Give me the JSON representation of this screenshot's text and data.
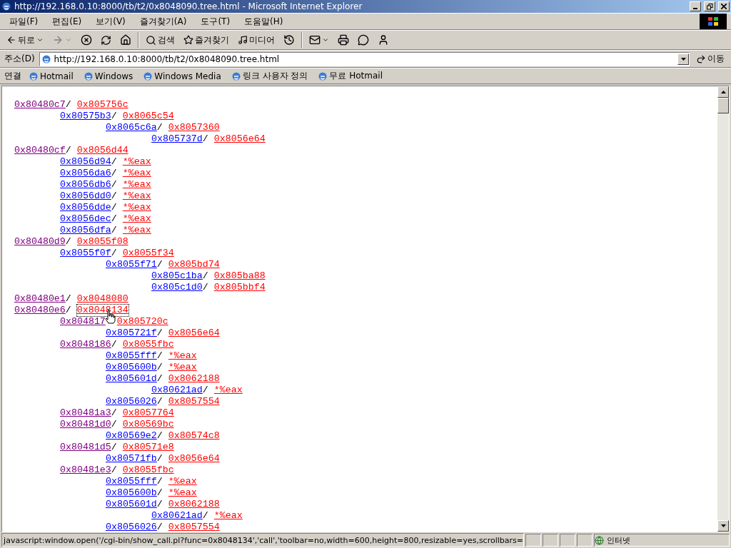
{
  "window": {
    "title": "http://192.168.0.10:8000/tb/t2/0x8048090.tree.html - Microsoft Internet Explorer"
  },
  "menu": [
    "파일(F)",
    "편집(E)",
    "보기(V)",
    "즐겨찾기(A)",
    "도구(T)",
    "도움말(H)"
  ],
  "toolbar": {
    "back": "뒤로",
    "search": "검색",
    "favorites": "즐겨찾기",
    "media": "미디어",
    "forward_disabled": true
  },
  "address_bar": {
    "label": "주소(D)",
    "value": "http://192.168.0.10:8000/tb/t2/0x8048090.tree.html",
    "go": "이동"
  },
  "links_bar": {
    "label": "연결",
    "links": [
      "Hotmail",
      "Windows",
      "Windows Media",
      "링크 사용자 정의",
      "무료 Hotmail"
    ]
  },
  "tree": [
    {
      "address": "0x80480c7",
      "visited": true,
      "separator": "/",
      "target": "0x805756c",
      "focused": false,
      "children": [
        {
          "address": "0x80575b3",
          "visited": false,
          "separator": "/",
          "target": "0x8065c54",
          "focused": false,
          "children": [
            {
              "address": "0x8065c6a",
              "visited": false,
              "separator": "/",
              "target": "0x8057360",
              "focused": false,
              "children": [
                {
                  "address": "0x805737d",
                  "visited": false,
                  "separator": "/",
                  "target": "0x8056e64",
                  "focused": false
                }
              ]
            }
          ]
        }
      ]
    },
    {
      "address": "0x80480cf",
      "visited": true,
      "separator": "/",
      "target": "0x8056d44",
      "focused": false,
      "children": [
        {
          "address": "0x8056d94",
          "visited": false,
          "separator": "/",
          "target": "*%eax",
          "focused": false
        },
        {
          "address": "0x8056da6",
          "visited": false,
          "separator": "/",
          "target": "*%eax",
          "focused": false
        },
        {
          "address": "0x8056db6",
          "visited": false,
          "separator": "/",
          "target": "*%eax",
          "focused": false
        },
        {
          "address": "0x8056dd0",
          "visited": false,
          "separator": "/",
          "target": "*%eax",
          "focused": false
        },
        {
          "address": "0x8056dde",
          "visited": false,
          "separator": "/",
          "target": "*%eax",
          "focused": false
        },
        {
          "address": "0x8056dec",
          "visited": false,
          "separator": "/",
          "target": "*%eax",
          "focused": false
        },
        {
          "address": "0x8056dfa",
          "visited": false,
          "separator": "/",
          "target": "*%eax",
          "focused": false
        }
      ]
    },
    {
      "address": "0x80480d9",
      "visited": true,
      "separator": "/",
      "target": "0x8055f08",
      "focused": false,
      "children": [
        {
          "address": "0x8055f0f",
          "visited": false,
          "separator": "/",
          "target": "0x8055f34",
          "focused": false,
          "children": [
            {
              "address": "0x8055f71",
              "visited": false,
              "separator": "/",
              "target": "0x805bd74",
              "focused": false,
              "children": [
                {
                  "address": "0x805c1ba",
                  "visited": false,
                  "separator": "/",
                  "target": "0x805ba88",
                  "focused": false
                },
                {
                  "address": "0x805c1d0",
                  "visited": false,
                  "separator": "/",
                  "target": "0x805bbf4",
                  "focused": false
                }
              ]
            }
          ]
        }
      ]
    },
    {
      "address": "0x80480e1",
      "visited": true,
      "separator": "/",
      "target": "0x8048080",
      "focused": false
    },
    {
      "address": "0x80480e6",
      "visited": true,
      "separator": "/",
      "target": "0x8048134",
      "focused": true,
      "children": [
        {
          "address": "0x804817",
          "visited": true,
          "target": "0x805720c",
          "focused": false,
          "children": [
            {
              "address": "0x805721f",
              "visited": false,
              "separator": "/",
              "target": "0x8056e64",
              "focused": false
            }
          ]
        },
        {
          "address": "0x8048186",
          "visited": true,
          "separator": "/",
          "target": "0x8055fbc",
          "focused": false,
          "children": [
            {
              "address": "0x8055fff",
              "visited": false,
              "separator": "/",
              "target": "*%eax",
              "focused": false
            },
            {
              "address": "0x805600b",
              "visited": false,
              "separator": "/",
              "target": "*%eax",
              "focused": false
            },
            {
              "address": "0x805601d",
              "visited": false,
              "separator": "/",
              "target": "0x8062188",
              "focused": false,
              "children": [
                {
                  "address": "0x80621ad",
                  "visited": false,
                  "separator": "/",
                  "target": "*%eax",
                  "focused": false
                }
              ]
            },
            {
              "address": "0x8056026",
              "visited": false,
              "separator": "/",
              "target": "0x8057554",
              "focused": false
            }
          ]
        },
        {
          "address": "0x80481a3",
          "visited": true,
          "separator": "/",
          "target": "0x8057764",
          "focused": false
        },
        {
          "address": "0x80481d0",
          "visited": true,
          "separator": "/",
          "target": "0x80569bc",
          "focused": false,
          "children": [
            {
              "address": "0x80569e2",
              "visited": false,
              "separator": "/",
              "target": "0x80574c8",
              "focused": false
            }
          ]
        },
        {
          "address": "0x80481d5",
          "visited": true,
          "separator": "/",
          "target": "0x80571e8",
          "focused": false,
          "children": [
            {
              "address": "0x80571fb",
              "visited": false,
              "separator": "/",
              "target": "0x8056e64",
              "focused": false
            }
          ]
        },
        {
          "address": "0x80481e3",
          "visited": true,
          "separator": "/",
          "target": "0x8055fbc",
          "focused": false,
          "children": [
            {
              "address": "0x8055fff",
              "visited": false,
              "separator": "/",
              "target": "*%eax",
              "focused": false
            },
            {
              "address": "0x805600b",
              "visited": false,
              "separator": "/",
              "target": "*%eax",
              "focused": false
            },
            {
              "address": "0x805601d",
              "visited": false,
              "separator": "/",
              "target": "0x8062188",
              "focused": false,
              "children": [
                {
                  "address": "0x80621ad",
                  "visited": false,
                  "separator": "/",
                  "target": "*%eax",
                  "focused": false
                }
              ]
            },
            {
              "address": "0x8056026",
              "visited": false,
              "separator": "/",
              "target": "0x8057554",
              "focused": false
            }
          ]
        }
      ]
    }
  ],
  "status_bar": {
    "text": "javascript:window.open('/cgi-bin/show_call.pl?func=0x8048134','call','toolbar=no,width=600,height=800,resizable=yes,scrollbars=",
    "zone": "인터넷"
  }
}
